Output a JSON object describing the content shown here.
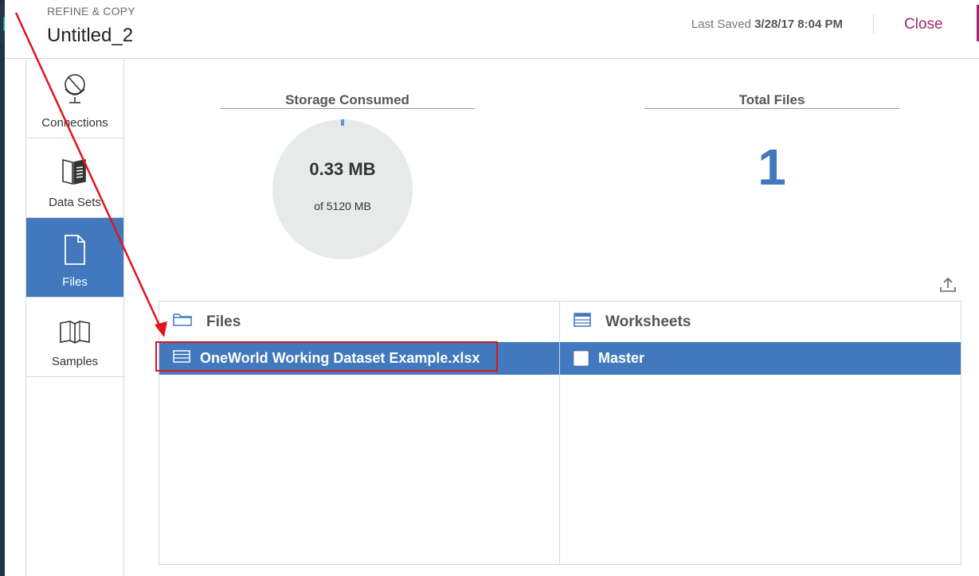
{
  "header": {
    "breadcrumb": "REFINE & COPY",
    "title": "Untitled_2",
    "last_saved_label": "Last Saved",
    "last_saved_value": "3/28/17 8:04 PM",
    "close_label": "Close"
  },
  "sidenav": {
    "items": [
      {
        "label": "Connections",
        "icon": "globe-icon",
        "active": false
      },
      {
        "label": "Data Sets",
        "icon": "book-icon",
        "active": false
      },
      {
        "label": "Files",
        "icon": "file-icon",
        "active": true
      },
      {
        "label": "Samples",
        "icon": "open-book-icon",
        "active": false
      }
    ]
  },
  "stats": {
    "storage": {
      "title": "Storage Consumed",
      "value": "0.33 MB",
      "of": "of 5120 MB",
      "used_fraction": 6.45e-05
    },
    "total_files": {
      "title": "Total Files",
      "value": "1"
    }
  },
  "files_panel": {
    "files_header": "Files",
    "worksheets_header": "Worksheets",
    "files": [
      {
        "name": "OneWorld Working Dataset Example.xlsx",
        "selected": true
      }
    ],
    "worksheets": [
      {
        "name": "Master",
        "checked": false,
        "selected": true
      }
    ]
  },
  "colors": {
    "accent": "#4178be",
    "close": "#a0286a",
    "annotation": "#e1141b",
    "donut_track": "#e6ebea"
  }
}
